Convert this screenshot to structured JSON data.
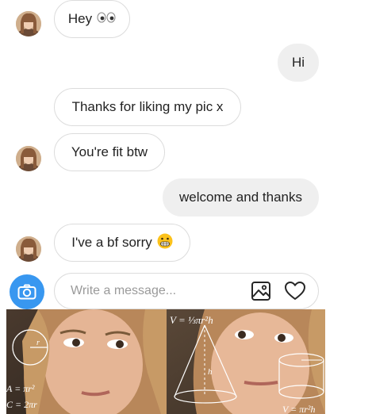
{
  "messages": [
    {
      "from": "them",
      "text": "Hey",
      "emoji": "eyes-emoji"
    },
    {
      "from": "me",
      "text": "Hi"
    },
    {
      "from": "them",
      "text": "Thanks for liking my pic x"
    },
    {
      "from": "them",
      "text": "You're fit btw"
    },
    {
      "from": "me",
      "text": "welcome and thanks"
    },
    {
      "from": "them",
      "text": "I've a bf sorry",
      "emoji": "grimacing-emoji"
    }
  ],
  "composer": {
    "placeholder": "Write a message...",
    "camera_icon": "camera-icon",
    "gallery_icon": "image-icon",
    "like_icon": "heart-icon",
    "accent_color": "#3897f0"
  },
  "meme": {
    "formulas": {
      "volume_cone": "V = ⅓πr²h",
      "area": "A = πr²",
      "circumference": "C = 2πr",
      "volume_cylinder": "V = πr²h",
      "r": "r",
      "h": "h"
    }
  }
}
